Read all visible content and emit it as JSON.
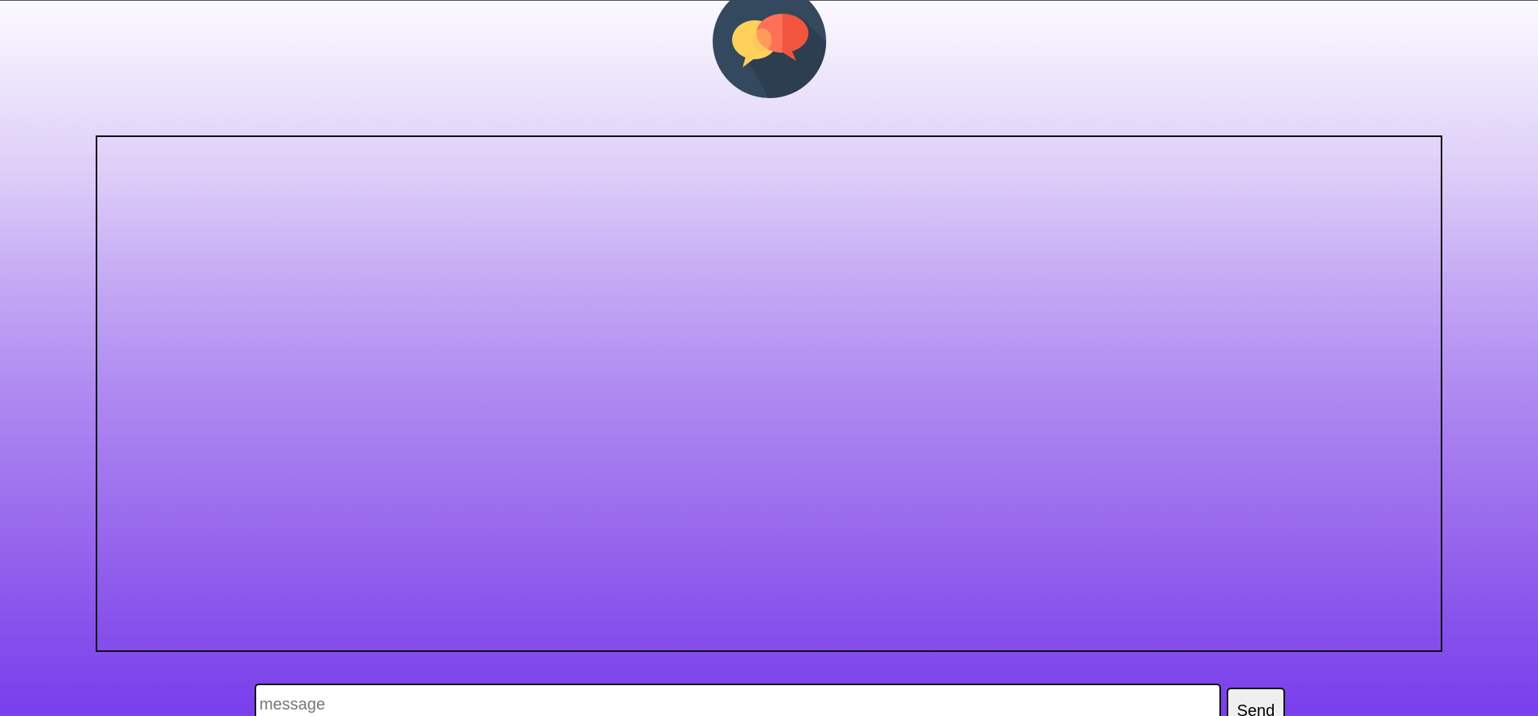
{
  "logo": {
    "icon": "chat-bubbles-icon",
    "colors": {
      "circle": "#34495e",
      "shadow": "#2c3e50",
      "left_bubble": "#ffd05b",
      "right_bubble": "#ff7058",
      "right_bubble_dark": "#f1543f"
    }
  },
  "chat": {
    "messages": []
  },
  "composer": {
    "input_placeholder": "message",
    "input_value": "",
    "send_label": "Send"
  }
}
